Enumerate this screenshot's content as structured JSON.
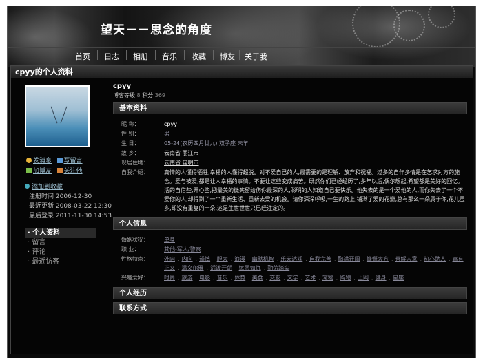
{
  "banner": {
    "title": "望天－－思念的角度"
  },
  "nav": [
    "首页",
    "日志",
    "相册",
    "音乐",
    "收藏",
    "博友",
    "关于我"
  ],
  "page_title": "cpyy的个人资料",
  "sidebar": {
    "actions": [
      "发消息",
      "写留言",
      "加博友",
      "关注他"
    ],
    "add_friend": "添加到收藏",
    "dates": [
      "注册时间 2006-12-30",
      "最近更新 2008-03-22 12:30",
      "最后登录 2011-11-30 14:53"
    ],
    "menu": [
      {
        "label": "· 个人资料",
        "active": true
      },
      {
        "label": "· 留言",
        "active": false
      },
      {
        "label": "· 评论",
        "active": false
      },
      {
        "label": "· 最近访客",
        "active": false
      }
    ]
  },
  "profile": {
    "username": "cpyy",
    "level_label": "博客等级",
    "level_value": "8",
    "points_label": "积分",
    "points_value": "369"
  },
  "basic": {
    "title": "基本资料",
    "rows": [
      {
        "label": "昵    称：",
        "value": "cpyy"
      },
      {
        "label": "性    别：",
        "value": "男"
      },
      {
        "label": "生    日：",
        "value": "05-24(农历四月廿九)  双子座      未羊"
      },
      {
        "label": "故    乡：",
        "value": "云南省  丽江市"
      },
      {
        "label": "现居住地：",
        "value": "云南省  昆明市"
      },
      {
        "label": "自我介绍：",
        "value": "真情的人懂得牺牲,幸福的人懂得超脱。对不爱自己的人,最需要的是理解、放弃和祝福。过多的自作多情是在乞求对方的施舍。爱与被爱,都是让人幸福的事情。不要让这些变成痛苦。既然你们已经经历了,多年以后,偶尔想起,希望都是美好的回忆。活的自信些,开心些,把最美的微笑留给伤你最深的人,聪明的人知道自己要快乐。他失去的是一个爱他的人,而你失去了一个不爱你的人,却得到了一个重新生活、重新去爱的机会。请你深深呼吸,一生的路上,铺满了爱的花瓣,总有那么一朵属于你,花儿虽多,却没有重复的一朵,这是生世世世只已经注定的。"
      }
    ]
  },
  "personal": {
    "title": "个人信息",
    "rows": [
      {
        "label": "婚姻状况：",
        "values": [
          "单身"
        ]
      },
      {
        "label": "职    业：",
        "values": [
          "其他-军人/警察"
        ]
      },
      {
        "label": "性格特点：",
        "values": [
          "外向",
          "内向",
          "谨慎",
          "胆大",
          "浪漫",
          "幽默机智",
          "乐天达观",
          "自我完善",
          "胸襟开阔",
          "慷慨大方",
          "善解人意",
          "热心助人",
          "富有正义",
          "温文尔雅",
          "活泼开朗",
          "嫉恶如仇",
          "勤劳踏实"
        ]
      },
      {
        "label": "兴趣爱好：",
        "values": [
          "时尚",
          "旅游",
          "电影",
          "音乐",
          "体育",
          "美食",
          "交友",
          "文学",
          "艺术",
          "宠物",
          "购物",
          "上网",
          "健身",
          "星座"
        ]
      }
    ]
  },
  "experience": {
    "title": "个人经历"
  },
  "contact": {
    "title": "联系方式"
  },
  "colors": {
    "background": "#0a0a0a",
    "link": "#888899",
    "bar": "#2e2e2e"
  }
}
